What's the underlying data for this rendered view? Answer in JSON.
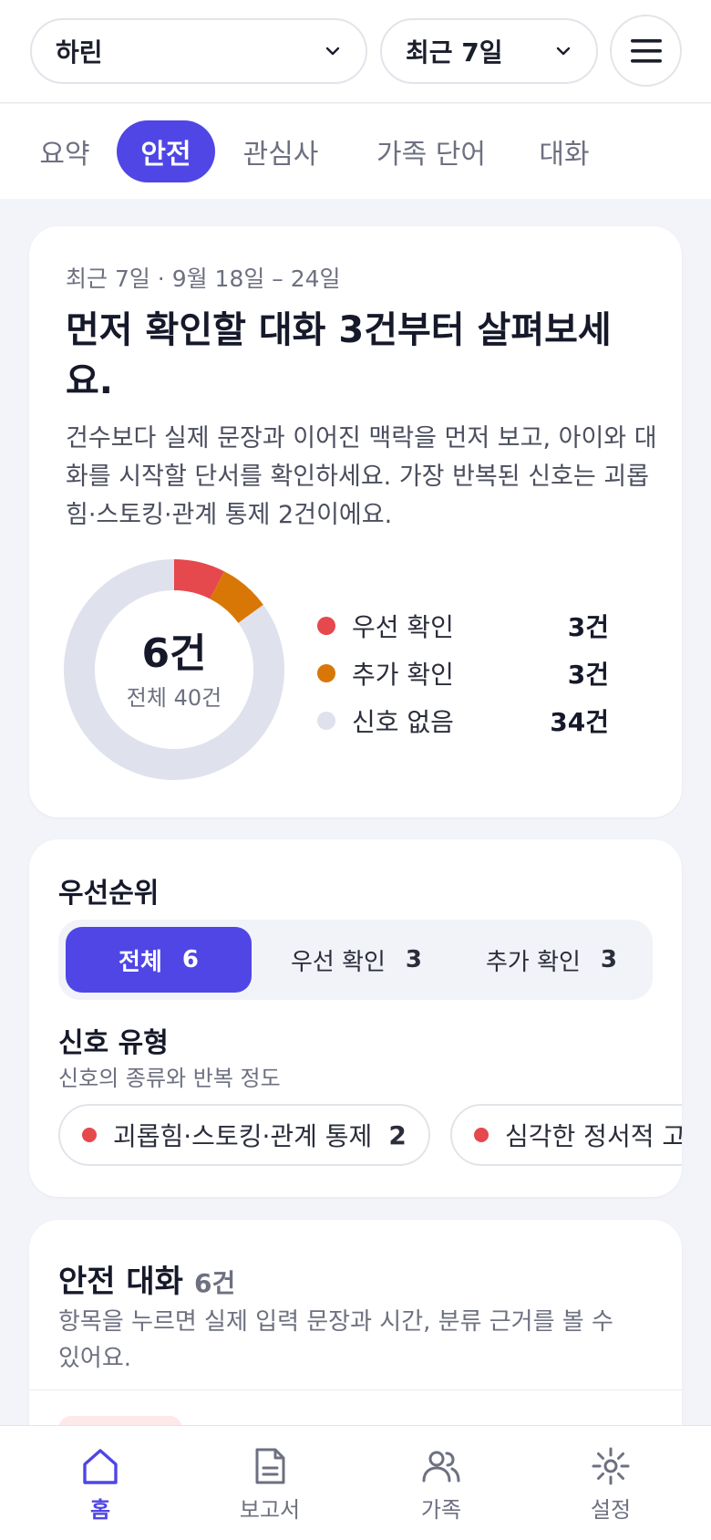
{
  "header": {
    "child_select": "하린",
    "period_select": "최근 7일"
  },
  "tabs": [
    "요약",
    "안전",
    "관심사",
    "가족 단어",
    "대화"
  ],
  "active_tab": "안전",
  "summary": {
    "meta": "최근 7일 · 9월 18일 – 24일",
    "headline": "먼저 확인할 대화 3건부터 살펴보세요.",
    "description": "건수보다 실제 문장과 이어진 맥락을 먼저 보고, 아이와 대화를 시작할 단서를 확인하세요. 가장 반복된 신호는 괴롭힘·스토킹·관계 통제 2건이에요.",
    "center_value": "6건",
    "center_sub": "전체 40건",
    "legend": [
      {
        "label": "우선 확인",
        "value": "3건",
        "color": "#e5484d"
      },
      {
        "label": "추가 확인",
        "value": "3건",
        "color": "#d97706"
      },
      {
        "label": "신호 없음",
        "value": "34건",
        "color": "#dfe2ec"
      }
    ]
  },
  "chart_data": {
    "type": "pie",
    "categories": [
      "우선 확인",
      "추가 확인",
      "신호 없음"
    ],
    "values": [
      3,
      3,
      34
    ],
    "colors": [
      "#e5484d",
      "#d97706",
      "#dfe2ec"
    ]
  },
  "priority": {
    "title": "우선순위",
    "segments": [
      {
        "label": "전체",
        "count": "6"
      },
      {
        "label": "우선 확인",
        "count": "3"
      },
      {
        "label": "추가 확인",
        "count": "3"
      }
    ],
    "signal_title": "신호 유형",
    "signal_sub": "신호의 종류와 반복 정도",
    "chips": [
      {
        "label": "괴롭힘·스토킹·관계 통제",
        "count": "2"
      },
      {
        "label": "심각한 정서적 고",
        "count": ""
      }
    ]
  },
  "safety": {
    "title": "안전 대화",
    "count": "6건",
    "description": "항목을 누르면 실제 입력 문장과 시간, 분류 근거를 볼 수 있어요."
  },
  "bottom_nav": [
    {
      "label": "홈",
      "icon": "home-icon"
    },
    {
      "label": "보고서",
      "icon": "document-icon"
    },
    {
      "label": "가족",
      "icon": "users-icon"
    },
    {
      "label": "설정",
      "icon": "settings-icon"
    }
  ],
  "colors": {
    "accent": "#4f46e5",
    "danger": "#e5484d",
    "warning": "#d97706"
  }
}
